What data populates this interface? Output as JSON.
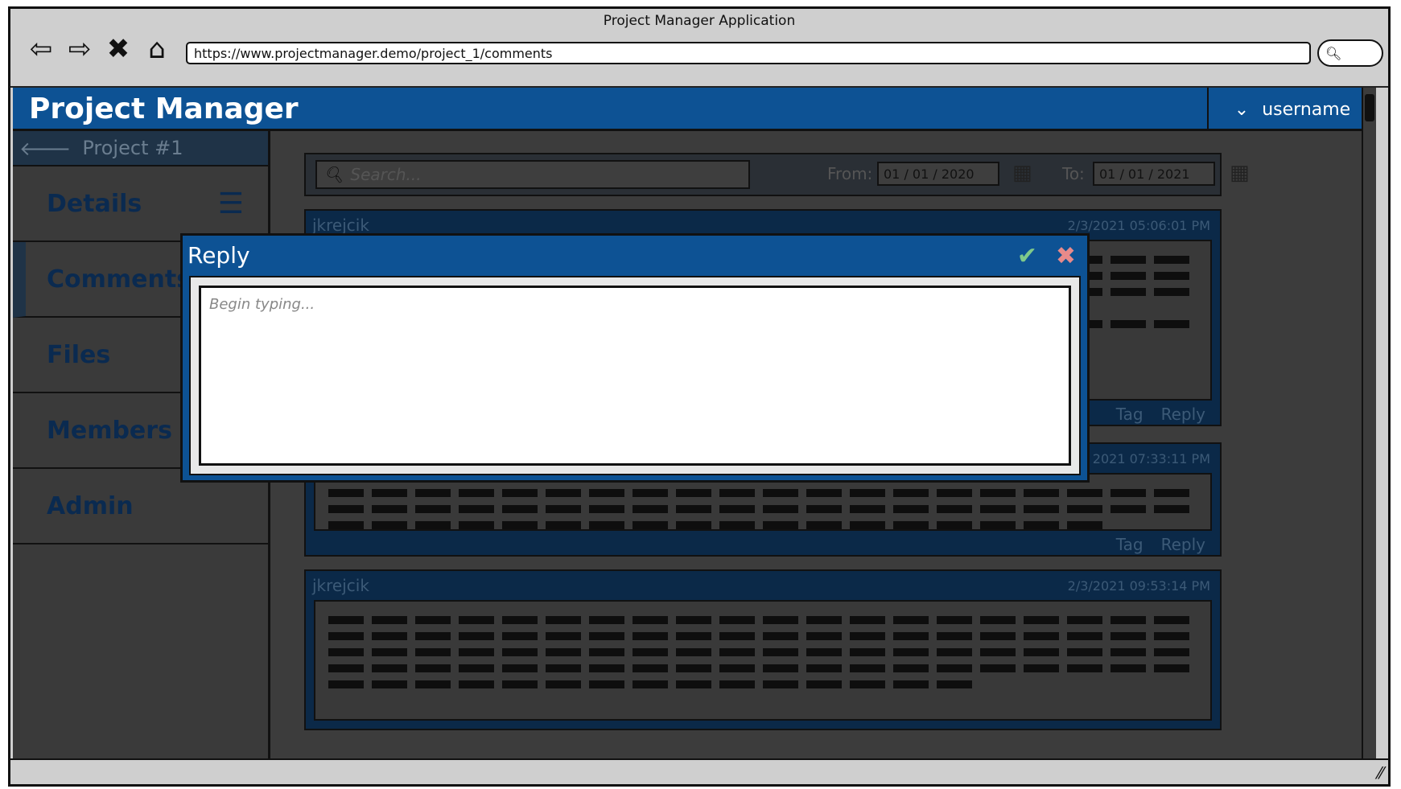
{
  "window": {
    "title": "Project Manager Application"
  },
  "browser": {
    "url": "https://www.projectmanager.demo/project_1/comments",
    "nav_icons": [
      "back-arrow-icon",
      "forward-arrow-icon",
      "close-icon",
      "home-icon"
    ]
  },
  "app": {
    "title": "Project Manager",
    "username": "username"
  },
  "sidebar": {
    "back_label": "Project #1",
    "items": [
      {
        "label": "Details"
      },
      {
        "label": "Comments"
      },
      {
        "label": "Files"
      },
      {
        "label": "Members"
      },
      {
        "label": "Admin"
      }
    ]
  },
  "toolbar": {
    "search_placeholder": "Search...",
    "from_label": "From:",
    "from_value": "01 / 01 / 2020",
    "to_label": "To:",
    "to_value": "01 / 01 / 2021"
  },
  "comments": [
    {
      "author": "jkrejcik",
      "time": "2/3/2021 05:06:01 PM",
      "tag_label": "Tag",
      "reply_label": "Reply"
    },
    {
      "author": "",
      "time": "2021 07:33:11 PM",
      "tag_label": "Tag",
      "reply_label": "Reply"
    },
    {
      "author": "jkrejcik",
      "time": "2/3/2021 09:53:14 PM"
    }
  ],
  "dialog": {
    "title": "Reply",
    "placeholder": "Begin typing..."
  },
  "colors": {
    "brand": "#0d5294",
    "confirm": "#7fc98a",
    "cancel": "#e88a8a"
  }
}
